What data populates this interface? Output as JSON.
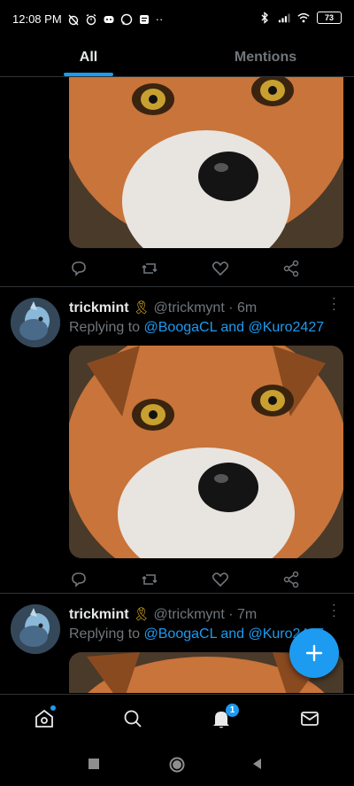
{
  "status_bar": {
    "time": "12:08 PM",
    "more": "··",
    "battery": "73"
  },
  "tabs": [
    {
      "label": "All"
    },
    {
      "label": "Mentions"
    }
  ],
  "tweets": [
    {
      "name": "trickmint",
      "ribbon": "🎗",
      "handle": "@trickmynt",
      "separator": "·",
      "time": "6m",
      "reply_prefix": "Replying to",
      "mention1": "@BoogaCL",
      "conj": "and",
      "mention2": "@Kuro2427"
    },
    {
      "name": "trickmint",
      "ribbon": "🎗",
      "handle": "@trickmynt",
      "separator": "·",
      "time": "7m",
      "reply_prefix": "Replying to",
      "mention1": "@BoogaCL",
      "conj": "and",
      "mention2": "@Kuro2427"
    }
  ],
  "notifications_badge": "1",
  "colors": {
    "accent": "#1d9bf0",
    "background": "#000000",
    "muted": "#71767b"
  }
}
